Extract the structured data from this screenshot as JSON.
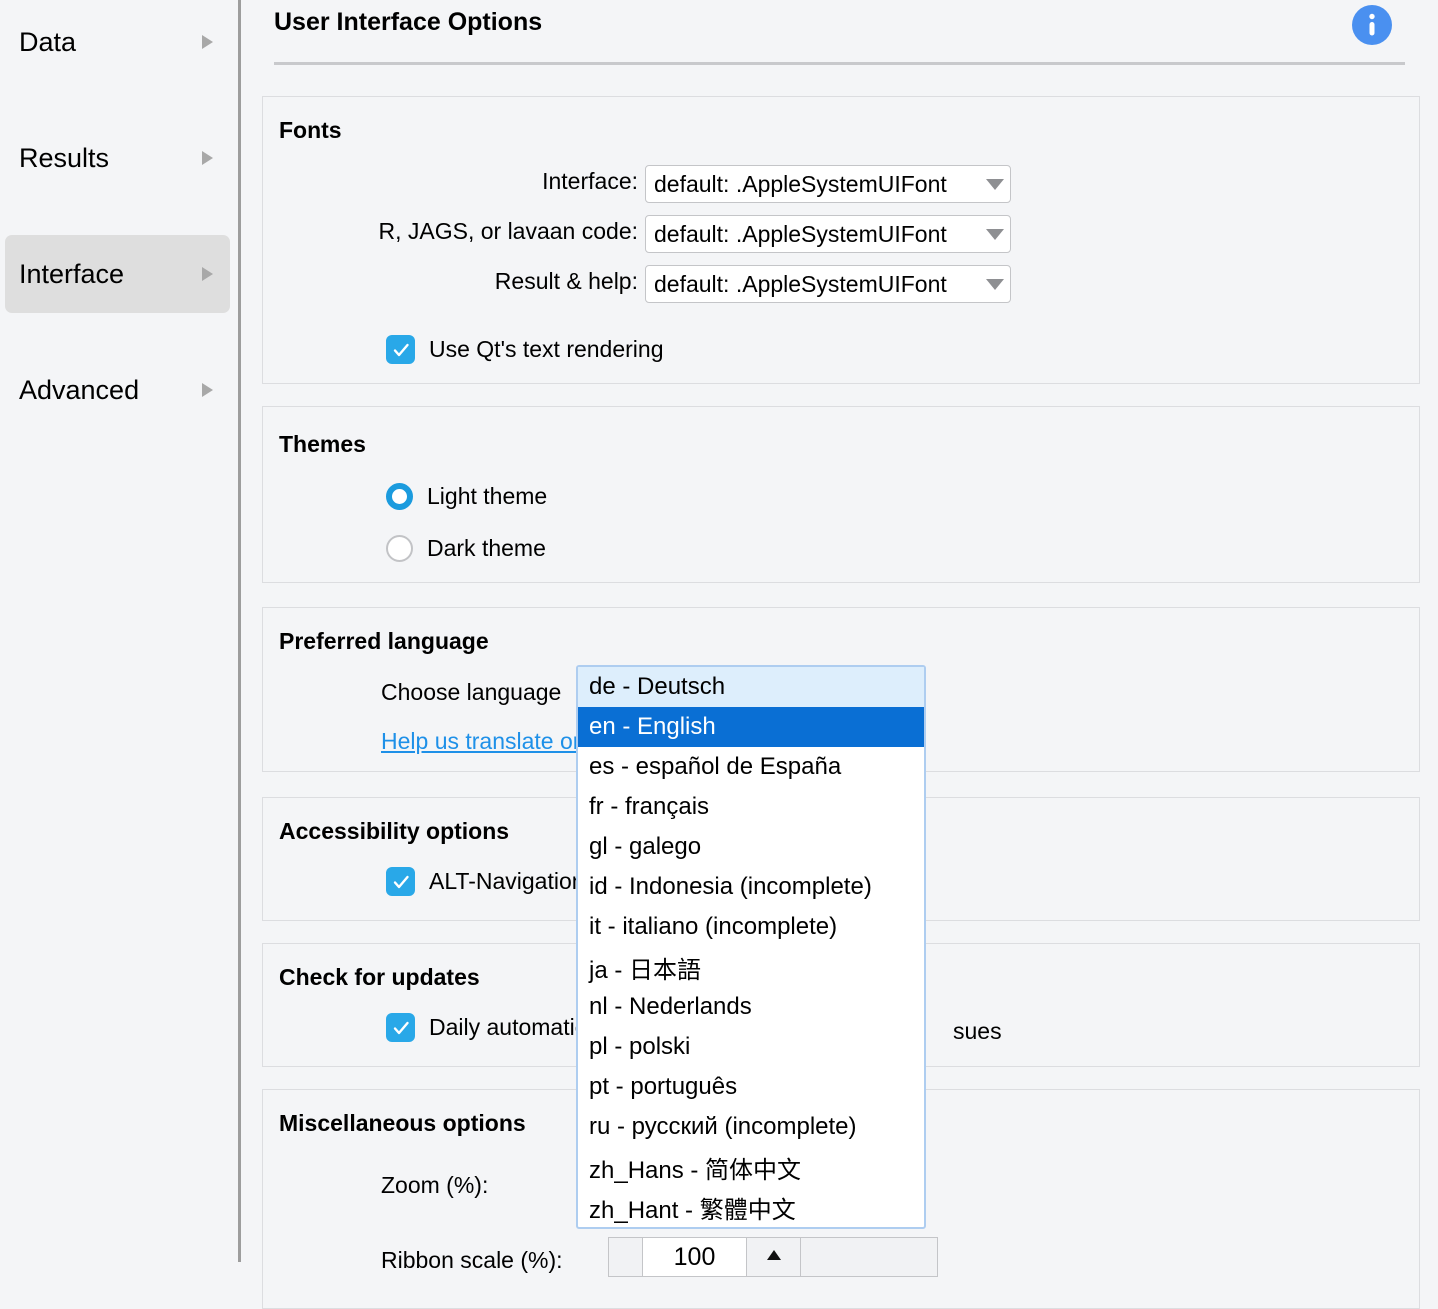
{
  "sidebar": {
    "items": [
      {
        "label": "Data",
        "name": "sidebar-item-data",
        "selected": false
      },
      {
        "label": "Results",
        "name": "sidebar-item-results",
        "selected": false
      },
      {
        "label": "Interface",
        "name": "sidebar-item-interface",
        "selected": true
      },
      {
        "label": "Advanced",
        "name": "sidebar-item-advanced",
        "selected": false
      }
    ]
  },
  "header": {
    "title": "User Interface Options",
    "info_icon": "info-icon"
  },
  "fonts": {
    "title": "Fonts",
    "interface_label": "Interface:",
    "interface_value": "default: .AppleSystemUIFont",
    "code_label": "R, JAGS, or lavaan code:",
    "code_value": "default: .AppleSystemUIFont",
    "result_label": "Result & help:",
    "result_value": "default: .AppleSystemUIFont",
    "qt_checkbox_label": "Use Qt's text rendering",
    "qt_checkbox_checked": true
  },
  "themes": {
    "title": "Themes",
    "options": [
      {
        "label": "Light theme",
        "selected": true
      },
      {
        "label": "Dark theme",
        "selected": false
      }
    ]
  },
  "language": {
    "title": "Preferred language",
    "choose_label": "Choose language",
    "help_link": "Help us translate or improve the language",
    "selected_value": "en - English",
    "options": [
      {
        "label": "de - Deutsch",
        "state": "hover"
      },
      {
        "label": "en - English",
        "state": "selected"
      },
      {
        "label": "es - español de España",
        "state": "normal"
      },
      {
        "label": "fr - français",
        "state": "normal"
      },
      {
        "label": "gl - galego",
        "state": "normal"
      },
      {
        "label": "id - Indonesia (incomplete)",
        "state": "normal"
      },
      {
        "label": "it - italiano (incomplete)",
        "state": "normal"
      },
      {
        "label": "ja - 日本語",
        "state": "normal"
      },
      {
        "label": "nl - Nederlands",
        "state": "normal"
      },
      {
        "label": "pl - polski",
        "state": "normal"
      },
      {
        "label": "pt - português",
        "state": "normal"
      },
      {
        "label": "ru - русский (incomplete)",
        "state": "normal"
      },
      {
        "label": "zh_Hans - 简体中文",
        "state": "normal"
      },
      {
        "label": "zh_Hant - 繁體中文",
        "state": "normal"
      }
    ]
  },
  "accessibility": {
    "title": "Accessibility options",
    "alt_nav_label": "ALT-Navigation",
    "alt_nav_checked": true
  },
  "updates": {
    "title": "Check for updates",
    "daily_label_start": "Daily automatic",
    "daily_label_end": "sues",
    "daily_checked": true
  },
  "misc": {
    "title": "Miscellaneous options",
    "zoom_label": "Zoom (%):",
    "ribbon_label": "Ribbon scale (%):",
    "ribbon_value": "100"
  },
  "colors": {
    "accent_blue": "#0a6fd4",
    "checkbox_blue": "#29a8e8",
    "radio_blue": "#1b9bde",
    "link_blue": "#1e90e8",
    "info_blue": "#4a90f0",
    "panel_bg": "#f4f5f7",
    "selected_sidebar": "#dedede"
  }
}
